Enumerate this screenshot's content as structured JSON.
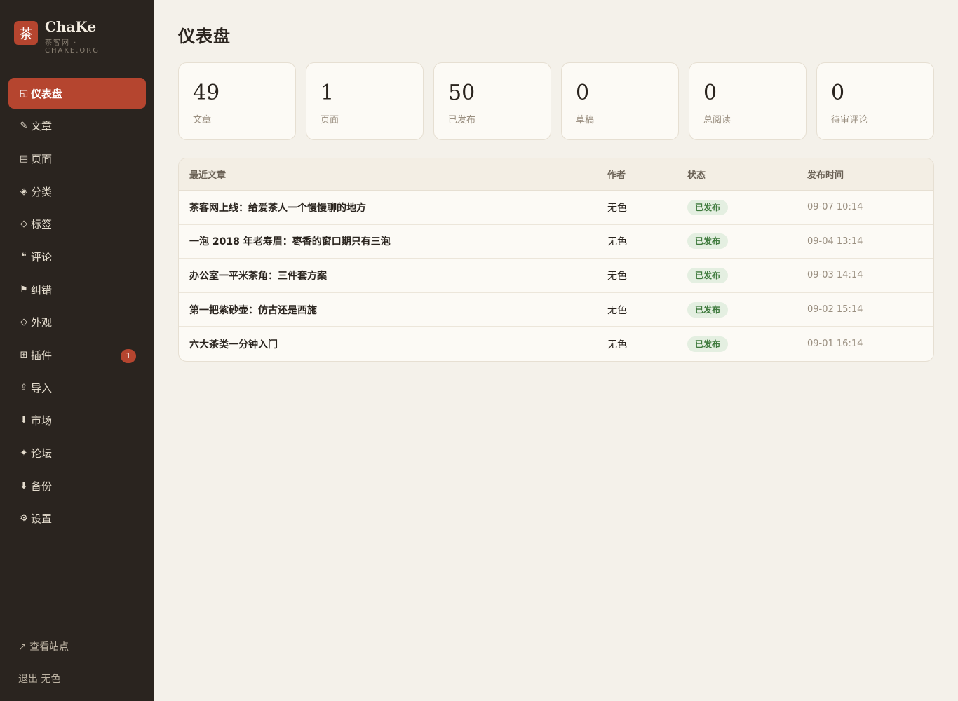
{
  "brand": {
    "logo_char": "茶",
    "name": "ChaKe",
    "subtitle": "茶客网 · CHAKE.ORG"
  },
  "nav": {
    "items": [
      {
        "icon": "◱",
        "label": "仪表盘",
        "active": true
      },
      {
        "icon": "✎",
        "label": "文章"
      },
      {
        "icon": "▤",
        "label": "页面"
      },
      {
        "icon": "◈",
        "label": "分类"
      },
      {
        "icon": "◇",
        "label": "标签"
      },
      {
        "icon": "❝",
        "label": "评论"
      },
      {
        "icon": "⚑",
        "label": "纠错"
      },
      {
        "icon": "◇",
        "label": "外观"
      },
      {
        "icon": "⊞",
        "label": "插件",
        "badge": "1"
      },
      {
        "icon": "⇪",
        "label": "导入"
      },
      {
        "icon": "⬇",
        "label": "市场"
      },
      {
        "icon": "✦",
        "label": "论坛"
      },
      {
        "icon": "⬇",
        "label": "备份"
      },
      {
        "icon": "⚙",
        "label": "设置"
      }
    ]
  },
  "footer": {
    "view_site": "↗ 查看站点",
    "logout": "退出 无色"
  },
  "page": {
    "title": "仪表盘"
  },
  "stats": [
    {
      "value": "49",
      "label": "文章"
    },
    {
      "value": "1",
      "label": "页面"
    },
    {
      "value": "50",
      "label": "已发布"
    },
    {
      "value": "0",
      "label": "草稿"
    },
    {
      "value": "0",
      "label": "总阅读"
    },
    {
      "value": "0",
      "label": "待审评论"
    }
  ],
  "recent": {
    "headers": {
      "title": "最近文章",
      "author": "作者",
      "status": "状态",
      "time": "发布时间"
    },
    "rows": [
      {
        "title": "茶客网上线：给爱茶人一个慢慢聊的地方",
        "author": "无色",
        "status": "已发布",
        "time": "09-07 10:14"
      },
      {
        "title": "一泡 2018 年老寿眉：枣香的窗口期只有三泡",
        "author": "无色",
        "status": "已发布",
        "time": "09-04 13:14"
      },
      {
        "title": "办公室一平米茶角：三件套方案",
        "author": "无色",
        "status": "已发布",
        "time": "09-03 14:14"
      },
      {
        "title": "第一把紫砂壶：仿古还是西施",
        "author": "无色",
        "status": "已发布",
        "time": "09-02 15:14"
      },
      {
        "title": "六大茶类一分钟入门",
        "author": "无色",
        "status": "已发布",
        "time": "09-01 16:14"
      }
    ]
  },
  "colors": {
    "accent": "#b5452f",
    "sidebar": "#2a241f",
    "background": "#f4f1ea",
    "published_badge_bg": "#e4efe1",
    "published_badge_text": "#3f7a3d"
  }
}
